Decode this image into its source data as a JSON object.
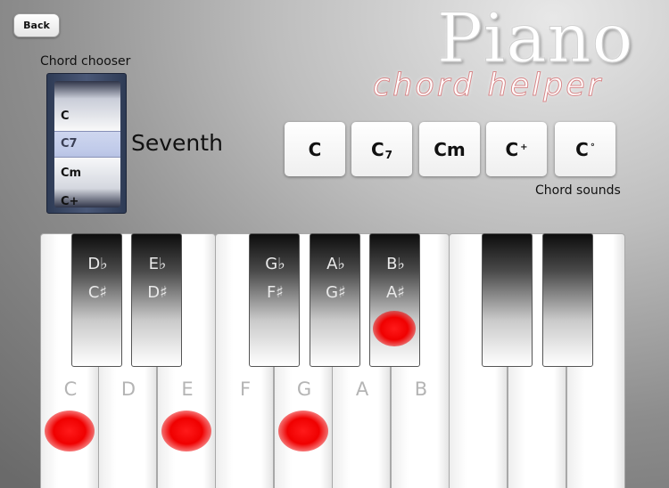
{
  "header": {
    "back_label": "Back",
    "title": "Piano",
    "subtitle": "chord helper"
  },
  "chooser": {
    "label": "Chord chooser",
    "items": [
      "C",
      "C7",
      "Cm",
      "C+"
    ],
    "selected_name": "Seventh"
  },
  "chord_buttons": [
    {
      "main": "C",
      "sub": "",
      "sup": ""
    },
    {
      "main": "C",
      "sub": "7",
      "sup": ""
    },
    {
      "main": "Cm",
      "sub": "",
      "sup": ""
    },
    {
      "main": "C",
      "sub": "",
      "sup": "+"
    },
    {
      "main": "C",
      "sub": "",
      "sup": "°"
    }
  ],
  "chord_sounds_label": "Chord sounds",
  "keyboard": {
    "white_labels": [
      "C",
      "D",
      "E",
      "F",
      "G",
      "A",
      "B",
      "",
      "",
      ""
    ],
    "black_labels": [
      {
        "top": "D♭",
        "bottom": "C♯"
      },
      {
        "top": "E♭",
        "bottom": "D♯"
      },
      {
        "top": "G♭",
        "bottom": "F♯"
      },
      {
        "top": "A♭",
        "bottom": "G♯"
      },
      {
        "top": "B♭",
        "bottom": "A♯"
      },
      {
        "top": "",
        "bottom": ""
      },
      {
        "top": "",
        "bottom": ""
      }
    ]
  },
  "colors": {
    "highlight": "#ff0000",
    "note_label": "#b4b4b4"
  }
}
